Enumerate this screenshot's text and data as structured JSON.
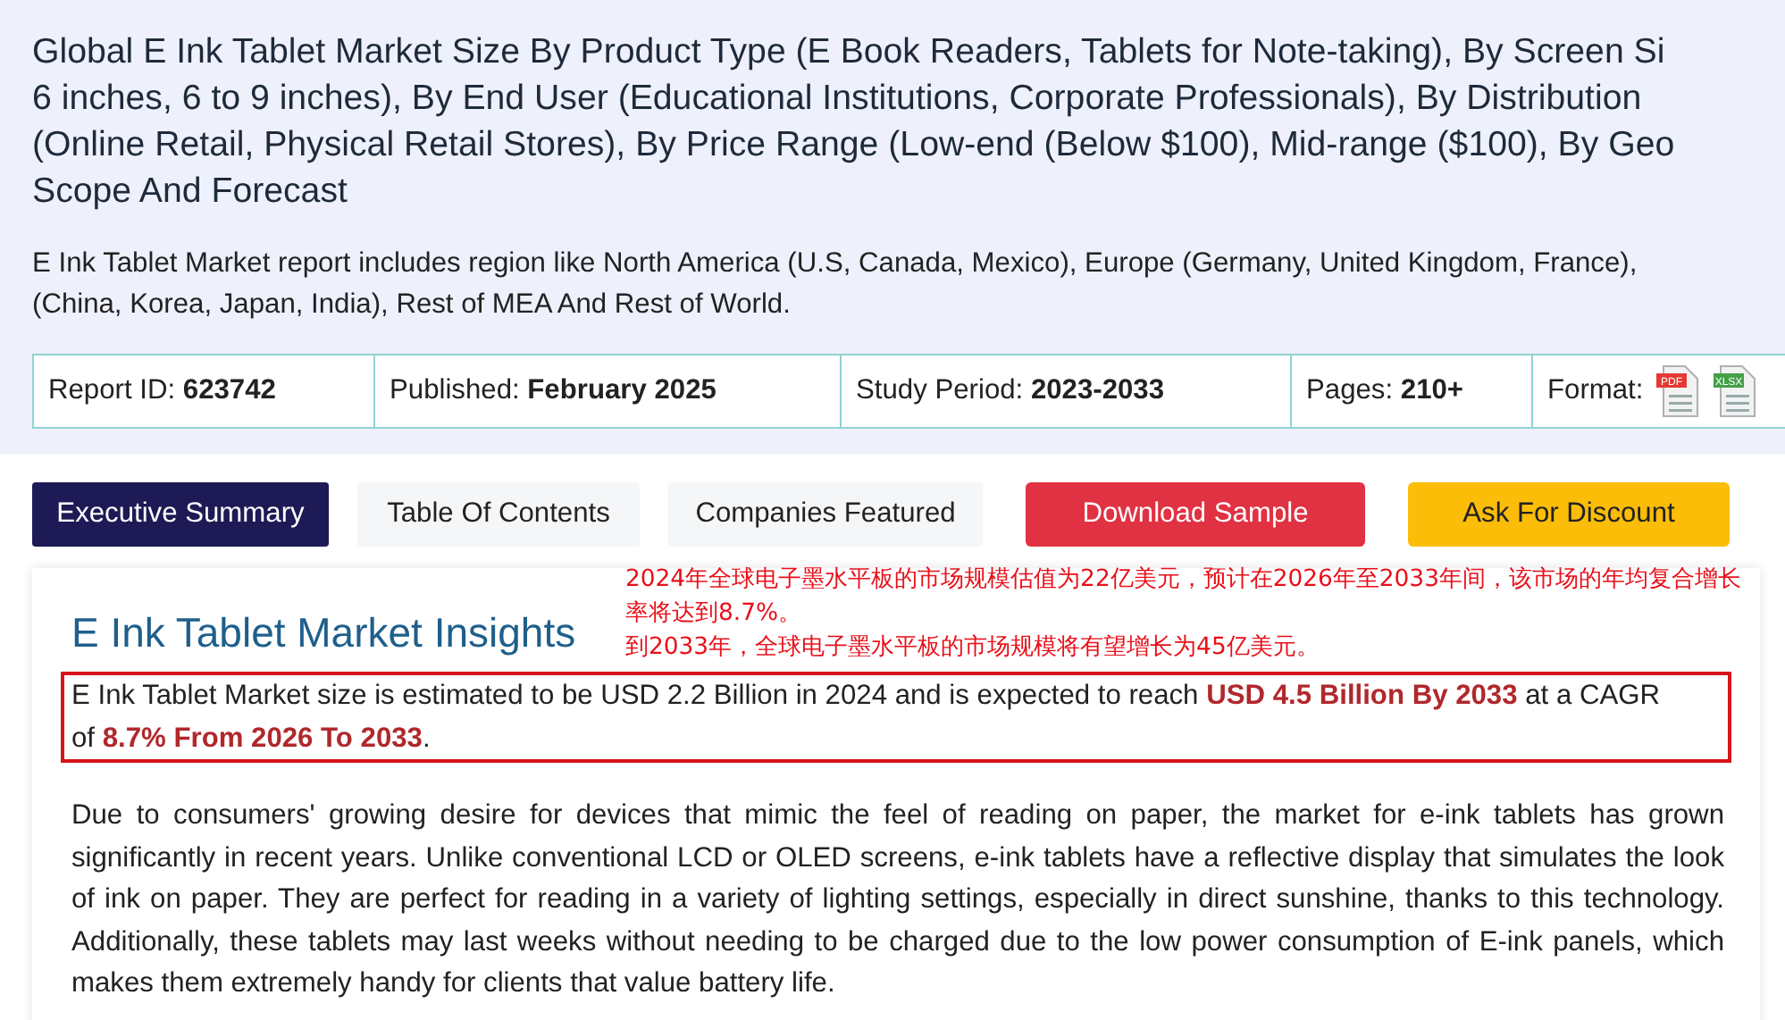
{
  "title_lines": [
    "Global E Ink Tablet Market Size By Product Type (E Book Readers, Tablets for Note-taking), By Screen Si",
    "6 inches, 6 to 9 inches), By End User (Educational Institutions, Corporate Professionals), By Distribution",
    "(Online Retail, Physical Retail Stores), By Price Range (Low-end (Below $100), Mid-range ($100), By Geo",
    "Scope And Forecast"
  ],
  "description_lines": [
    "E Ink Tablet Market report includes region like North America (U.S, Canada, Mexico), Europe (Germany, United Kingdom, France),",
    "(China, Korea, Japan, India), Rest of MEA And Rest of World."
  ],
  "info_bar": [
    {
      "label": "Report ID:",
      "value": "623742"
    },
    {
      "label": "Published:",
      "value": "February 2025"
    },
    {
      "label": "Study Period:",
      "value": "2023-2033"
    },
    {
      "label": "Pages:",
      "value": "210+"
    }
  ],
  "format_label": "Format:",
  "formats": [
    {
      "kind": "pdf",
      "tag": "PDF"
    },
    {
      "kind": "xlsx",
      "tag": "XLSX"
    }
  ],
  "tabs": [
    {
      "label": "Executive Summary",
      "selected": true
    },
    {
      "label": "Table Of Contents",
      "selected": false
    },
    {
      "label": "Companies Featured",
      "selected": false
    }
  ],
  "actions": [
    {
      "label": "Download Sample",
      "kind": "download"
    },
    {
      "label": "Ask For Discount",
      "kind": "discount"
    }
  ],
  "annotation": [
    "2024年全球电子墨水平板的市场规模估值为22亿美元，预计在2026年至2033年间，该市场的年均复合增长率将达到8.7%。",
    "到2033年，全球电子墨水平板的市场规模将有望增长为45亿美元。"
  ],
  "section_title": "E Ink Tablet Market Insights",
  "highlight": "E Ink Tablet Market size is estimated to be USD 2.2 Billion in 2024 and is expected to reach **USD 4.5 Billion By 2033** at a CAGR of **8.7% From 2026 To 2033**.",
  "body": "Due to consumers' growing desire for devices that mimic the feel of reading on paper, the market for e-ink tablets has grown significantly in recent years. Unlike conventional LCD or OLED screens, e-ink tablets have a reflective display that simulates the look of ink on paper. They are perfect for reading in a variety of lighting settings, especially in direct sunshine, thanks to this technology. Additionally, these tablets may last weeks without needing to be charged due to the low power consumption of E-ink panels, which makes them extremely handy for clients that value battery life."
}
